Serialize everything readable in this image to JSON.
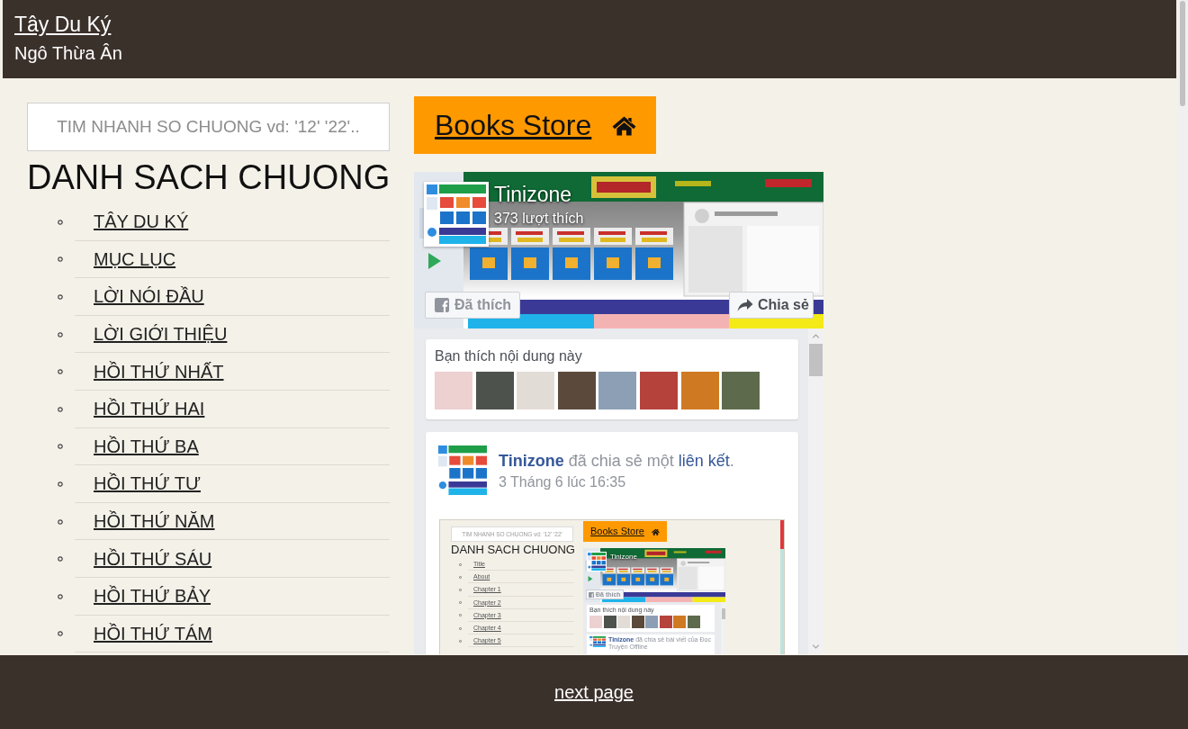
{
  "header": {
    "title": "Tây Du Ký",
    "author": "Ngô Thừa Ân"
  },
  "sidebar": {
    "search": {
      "placeholder": "TIM NHANH SO CHUONG vd: '12' '22'.."
    },
    "heading": "DANH SACH CHUONG",
    "chapters": [
      "TÂY DU KÝ",
      "MỤC LỤC",
      "LỜI NÓI ĐẦU",
      "LỜI GIỚI THIỆU",
      "HỒI THỨ NHẤT",
      "HỒI THỨ HAI",
      "HỒI THỨ BA",
      "HỒI THỨ TƯ",
      "HỒI THỨ NĂM",
      "HỒI THỨ SÁU",
      "HỒI THỨ BẢY",
      "HỒI THỨ TÁM"
    ]
  },
  "store_button": {
    "label": "Books Store"
  },
  "facebook_widget": {
    "page_name": "Tinizone",
    "likes": "373 lượt thích",
    "like_button": {
      "label": "Đã thích"
    },
    "share_button": {
      "label": "Chia sẻ"
    },
    "friends_card": {
      "title": "Bạn thích nội dung này",
      "avatars": [
        {
          "kind": "photo"
        },
        {
          "kind": "photo"
        },
        {
          "kind": "photo"
        },
        {
          "kind": "photo"
        },
        {
          "kind": "photo"
        },
        {
          "kind": "photo"
        },
        {
          "kind": "photo"
        },
        {
          "kind": "photo"
        }
      ]
    },
    "post": {
      "author": "Tinizone",
      "action": "đã chia sẻ một",
      "link": "liên kết",
      "end": ".",
      "date": "3 Tháng 6 lúc 16:35",
      "preview": {
        "search": {
          "placeholder": "TIM NHANH SO CHUONG vd: '12' '22'"
        },
        "heading": "DANH SACH CHUONG",
        "chapters": [
          "Title",
          "About",
          "Chapter 1",
          "Chapter 2",
          "Chapter 3",
          "Chapter 4",
          "Chapter 5"
        ],
        "store_button": {
          "label": "Books Store"
        },
        "facebook_widget": {
          "page_name": "Tinizone",
          "like_button": {
            "label": "Đã thích"
          },
          "friends_card": {
            "title": "Bạn thích nội dung này",
            "avatars": [
              {
                "kind": "photo"
              },
              {
                "kind": "photo"
              },
              {
                "kind": "photo"
              },
              {
                "kind": "photo"
              },
              {
                "kind": "photo"
              },
              {
                "kind": "photo"
              },
              {
                "kind": "photo"
              },
              {
                "kind": "photo"
              }
            ]
          },
          "post": {
            "author": "Tinizone",
            "action": "đã chia sẻ bài viết của Đọc Truyện Offline"
          }
        }
      }
    }
  },
  "footer": {
    "next_link": "next page"
  }
}
